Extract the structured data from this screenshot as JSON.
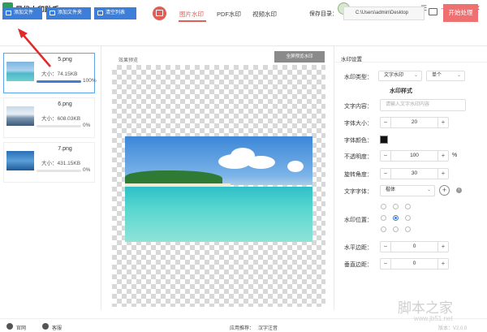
{
  "app": {
    "title": "星优水印助手"
  },
  "window": {
    "settings_icon": "sliders-icon",
    "min_icon": "minimize-icon",
    "max_icon": "maximize-icon",
    "close_icon": "close-icon"
  },
  "toolbar": {
    "add_file": "添加文件",
    "add_folder": "添加文件夹",
    "clear_list": "清空列表",
    "tabs": [
      "图片水印",
      "PDF水印",
      "视频水印"
    ],
    "save_label": "保存目录：",
    "save_path": "C:\\Users\\admin\\Desktop",
    "start_label": "开始处理",
    "accent": "#e25d55",
    "primary": "#3d7fd8"
  },
  "files": [
    {
      "name": "5.png",
      "size": "大小：74.15KB",
      "pct": "100%",
      "progress": 1.0
    },
    {
      "name": "6.png",
      "size": "大小：608.03KB",
      "pct": "0%",
      "progress": 0
    },
    {
      "name": "7.png",
      "size": "大小：431.15KB",
      "pct": "0%",
      "progress": 0
    }
  ],
  "preview": {
    "title": "效果预览",
    "fullscreen": "全屏预览水印"
  },
  "settings": {
    "title": "水印设置",
    "type_label": "水印类型：",
    "type_value": "文字水印",
    "mode_value": "单个",
    "section": "水印样式",
    "content_label": "文字内容：",
    "content_placeholder": "请输入文字水印内容",
    "size_label": "字体大小：",
    "size_value": "20",
    "color_label": "字体颜色：",
    "opacity_label": "不透明度：",
    "opacity_value": "100",
    "opacity_unit": "%",
    "rotate_label": "旋转角度：",
    "rotate_value": "30",
    "font_label": "文字字体：",
    "font_value": "楷体",
    "position_label": "水印位置：",
    "hmargin_label": "水平边距：",
    "hmargin_value": "0",
    "vmargin_label": "垂直边距：",
    "vmargin_value": "0",
    "minus": "−",
    "plus": "+"
  },
  "status": {
    "website": "官网",
    "help": "客服",
    "recommend": "应用推荐：",
    "recommend_app": "汉字注音",
    "version": "版本：V2.0.0"
  },
  "watermark": {
    "logo": "脚本之家",
    "url": "www.jb51.net"
  }
}
